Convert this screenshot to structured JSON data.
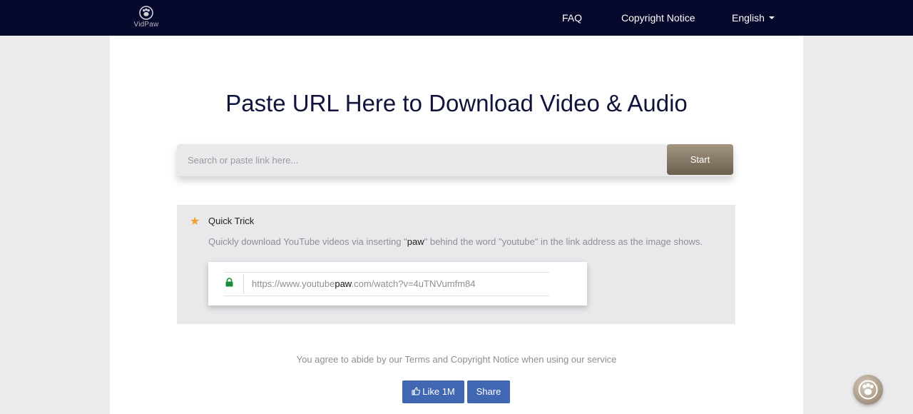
{
  "header": {
    "logo_text": "VidPaw",
    "logo_icon": "paw-icon",
    "nav": {
      "faq": "FAQ",
      "copyright": "Copyright Notice",
      "language": "English"
    }
  },
  "main": {
    "headline": "Paste URL Here to Download Video & Audio",
    "search": {
      "placeholder": "Search or paste link here...",
      "button_label": "Start"
    },
    "quick_trick": {
      "title": "Quick Trick",
      "desc_before": "Quickly download YouTube videos via inserting \"",
      "desc_highlight": "paw",
      "desc_after": "\" behind the word \"youtube\" in the link address as the image shows.",
      "example_url_prefix": "https://www.youtube",
      "example_url_highlight": "paw",
      "example_url_suffix": ".com/watch?v=4uTNVumfm84"
    },
    "agreement": "You agree to abide by our Terms and Copyright Notice when using our service",
    "social": {
      "like_label": "Like 1M",
      "share_label": "Share"
    }
  },
  "colors": {
    "header_bg": "#06082c",
    "accent_star": "#f0a030",
    "facebook_blue": "#4267b2",
    "start_button": "#8a7b68",
    "lock_green": "#1a8a3c"
  }
}
